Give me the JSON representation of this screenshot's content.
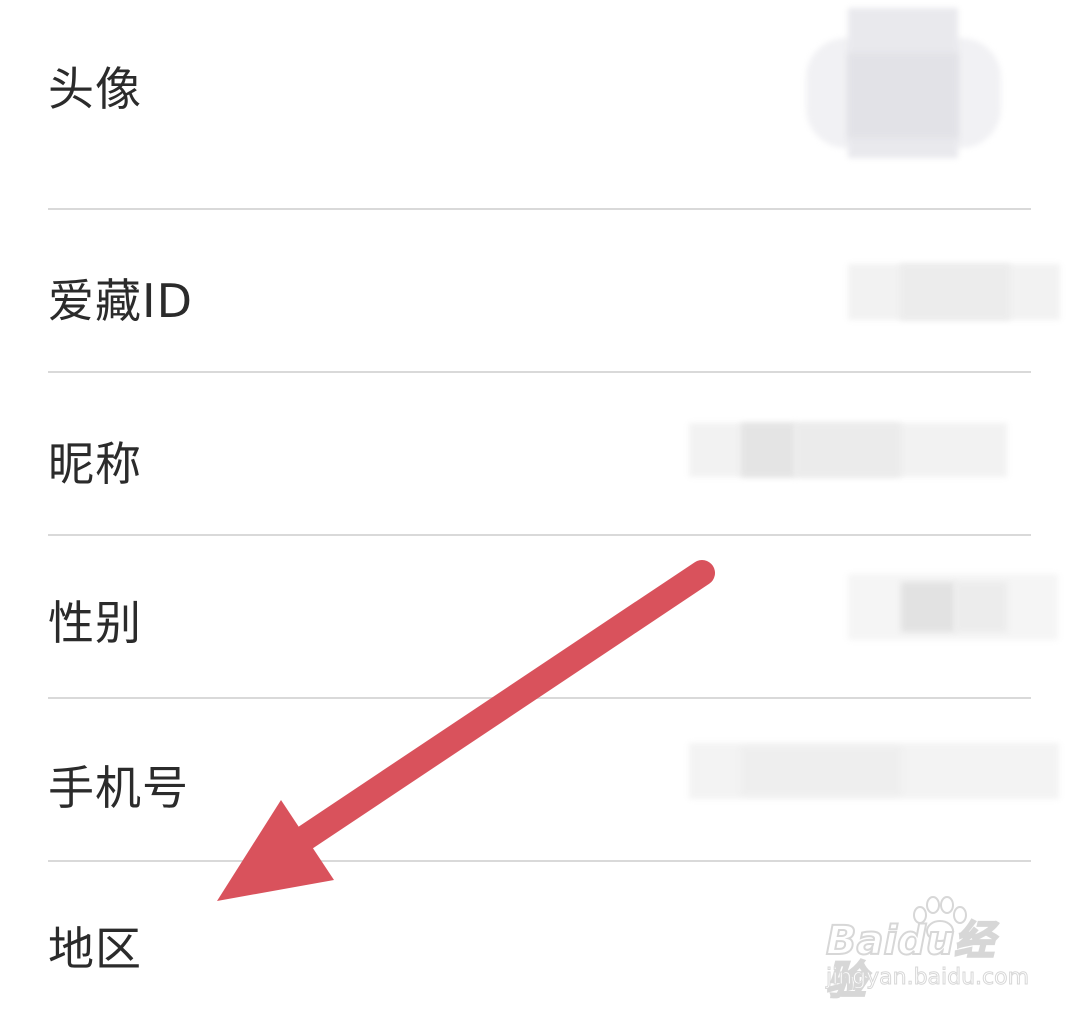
{
  "profile": {
    "rows": [
      {
        "label": "头像"
      },
      {
        "label": "爱藏ID"
      },
      {
        "label": "昵称"
      },
      {
        "label": "性别"
      },
      {
        "label": "手机号"
      },
      {
        "label": "地区"
      }
    ]
  },
  "annotation": {
    "arrow_color": "#d9525c"
  },
  "watermark": {
    "logo": "Baidu经验",
    "url": "jingyan.baidu.com"
  }
}
